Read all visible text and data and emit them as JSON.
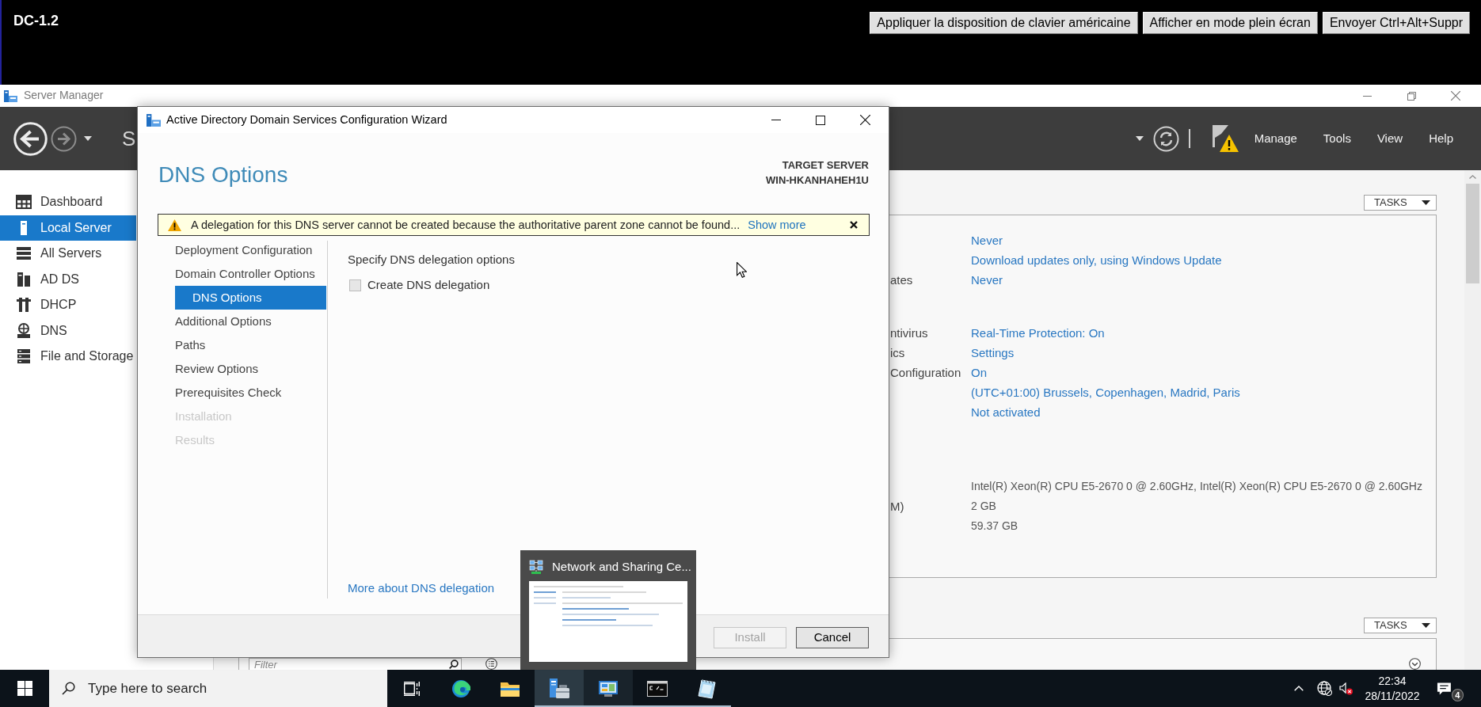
{
  "remote_bar": {
    "title": "DC-1.2",
    "buttons": [
      "Appliquer la disposition de clavier américaine",
      "Afficher en mode plein écran",
      "Envoyer Ctrl+Alt+Suppr"
    ]
  },
  "server_manager": {
    "title": "Server Manager",
    "header": {
      "title": "S",
      "menu": [
        "Manage",
        "Tools",
        "View",
        "Help"
      ]
    },
    "sidebar": {
      "items": [
        {
          "label": "Dashboard",
          "selected": false
        },
        {
          "label": "Local Server",
          "selected": true
        },
        {
          "label": "All Servers",
          "selected": false
        },
        {
          "label": "AD DS",
          "selected": false
        },
        {
          "label": "DHCP",
          "selected": false
        },
        {
          "label": "DNS",
          "selected": false
        },
        {
          "label": "File and Storage",
          "selected": false
        }
      ]
    },
    "properties_panel": {
      "tasks": "TASKS",
      "groups": [
        [
          {
            "value": "Never",
            "kind": "link"
          },
          {
            "value": "Download updates only, using Windows Update",
            "kind": "link"
          },
          {
            "label": "ates",
            "value": "Never",
            "kind": "link"
          }
        ],
        [
          {
            "label": "ntivirus",
            "value": "Real-Time Protection: On",
            "kind": "link"
          },
          {
            "label": "ics",
            "value": "Settings",
            "kind": "link"
          },
          {
            "label": "Configuration",
            "value": "On",
            "kind": "link"
          },
          {
            "value": "(UTC+01:00) Brussels, Copenhagen, Madrid, Paris",
            "kind": "link"
          },
          {
            "value": "Not activated",
            "kind": "link"
          }
        ],
        [
          {
            "value": "Intel(R) Xeon(R) CPU E5-2670 0 @ 2.60GHz, Intel(R) Xeon(R) CPU E5-2670 0 @ 2.60GHz",
            "kind": "text"
          },
          {
            "label": "M)",
            "value": "2 GB",
            "kind": "text"
          },
          {
            "value": "59.37 GB",
            "kind": "text"
          }
        ]
      ]
    },
    "events_panel": {
      "tasks": "TASKS",
      "filter": {
        "placeholder": "Filter"
      }
    }
  },
  "wizard": {
    "title": "Active Directory Domain Services Configuration Wizard",
    "heading": "DNS Options",
    "target_label": "TARGET SERVER",
    "target_server": "WIN-HKANHAHEH1U",
    "alert": {
      "message": "A delegation for this DNS server cannot be created because the authoritative parent zone cannot be found...",
      "link": "Show more"
    },
    "steps": [
      {
        "label": "Deployment Configuration",
        "selected": false,
        "disabled": false
      },
      {
        "label": "Domain Controller Options",
        "selected": false,
        "disabled": false
      },
      {
        "label": "DNS Options",
        "selected": true,
        "disabled": false
      },
      {
        "label": "Additional Options",
        "selected": false,
        "disabled": false
      },
      {
        "label": "Paths",
        "selected": false,
        "disabled": false
      },
      {
        "label": "Review Options",
        "selected": false,
        "disabled": false
      },
      {
        "label": "Prerequisites Check",
        "selected": false,
        "disabled": false
      },
      {
        "label": "Installation",
        "selected": false,
        "disabled": true
      },
      {
        "label": "Results",
        "selected": false,
        "disabled": true
      }
    ],
    "section_title": "Specify DNS delegation options",
    "options": [
      {
        "label": "Create DNS delegation",
        "checked": false
      }
    ],
    "help_link": "More about DNS delegation",
    "buttons": [
      {
        "label": "Install",
        "disabled": true
      },
      {
        "label": "Cancel",
        "disabled": false
      }
    ]
  },
  "taskbar_preview": {
    "title": "Network and Sharing Ce..."
  },
  "taskbar": {
    "search": {
      "placeholder": "Type here to search"
    },
    "apps": [
      {
        "running": false,
        "active": false,
        "hovered": false
      },
      {
        "running": false,
        "active": false,
        "hovered": false
      },
      {
        "running": true,
        "active": true,
        "hovered": false
      },
      {
        "running": true,
        "active": false,
        "hovered": true
      },
      {
        "running": true,
        "active": false,
        "hovered": false
      },
      {
        "running": true,
        "active": false,
        "hovered": false
      }
    ],
    "time": "22:34",
    "date": "28/11/2022",
    "notifications": "4"
  }
}
